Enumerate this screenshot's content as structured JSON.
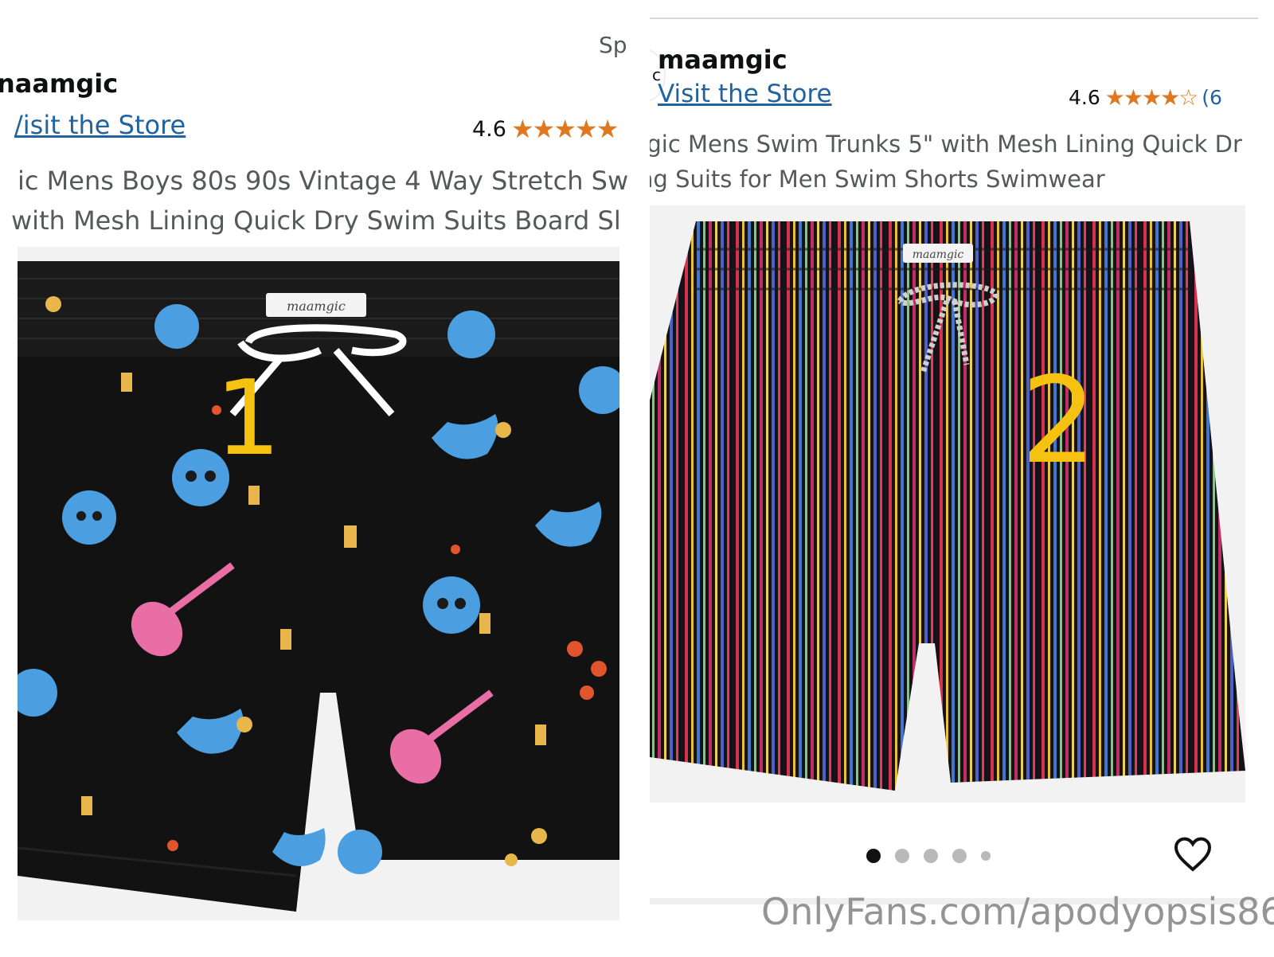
{
  "left": {
    "sponsored": "Sp",
    "brand": "naamgic",
    "store_link": "/isit the Store",
    "rating": "4.6",
    "title_line1": "ic Mens Boys 80s 90s Vintage 4 Way Stretch Sw",
    "title_line2": "with Mesh Lining Quick Dry Swim Suits Board Sl",
    "image_number": "1",
    "tag": "maamgic"
  },
  "right": {
    "avatar_letter": "c",
    "brand": "maamgic",
    "store_link": "Visit the Store",
    "rating": "4.6",
    "rating_count": "(6",
    "title_line1": "ngic Mens Swim Trunks 5\" with Mesh Lining Quick Dr",
    "title_line2": "ing Suits for Men Swim Shorts Swimwear",
    "image_number": "2",
    "tag": "maamgic"
  },
  "carousel": {
    "total_dots": 5,
    "active_index": 0
  },
  "watermark": "OnlyFans.com/apodyopsis86",
  "colors": {
    "star": "#de7921",
    "link": "#2162a1",
    "number_overlay": "#f5c211"
  },
  "icons": [
    "star-icon",
    "heart-icon"
  ]
}
